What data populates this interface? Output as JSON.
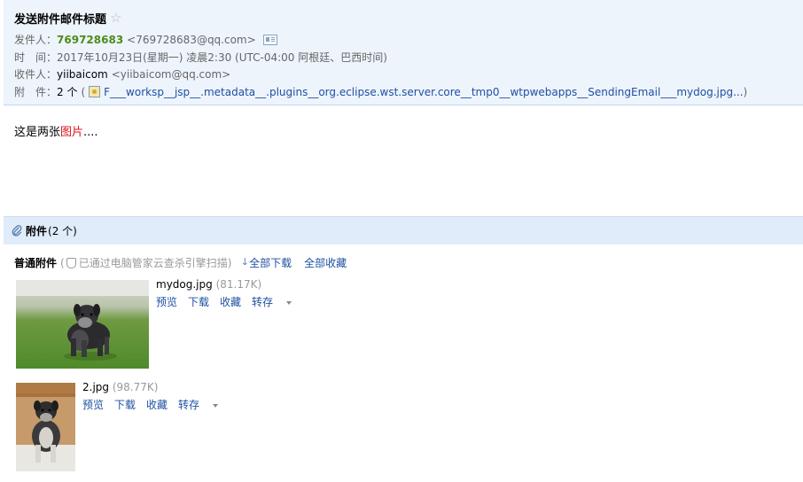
{
  "email": {
    "subject": "发送附件邮件标题",
    "star_icon": "star-outline-icon",
    "sender_label": "发件人：",
    "sender_name": "769728683",
    "sender_address": "<769728683@qq.com>",
    "contact_card_icon": "contact-card-icon",
    "time_label": "时　间：",
    "time_value": "2017年10月23日(星期一) 凌晨2:30 (UTC-04:00 阿根廷、巴西时间)",
    "recipient_label": "收件人：",
    "recipient_name": "yiibaicom",
    "recipient_address": "<yiibaicom@qq.com>",
    "attachment_label": "附　件：",
    "attachment_count": "2 个",
    "attachment_paren_open": "(",
    "attachment_paren_close": ")",
    "attachment_link": "F___worksp__jsp__.metadata__.plugins__org.eclipse.wst.server.core__tmp0__wtpwebapps__SendingEmail___mydog.jpg...",
    "body_text_before": "这是两张",
    "body_text_red": "图片",
    "body_text_after": "...."
  },
  "attachments_panel": {
    "title": "附件",
    "count": "(2 个)",
    "kind_label": "普通附件",
    "scan_text_open": "(",
    "scan_text": "已通过电脑管家云查杀引擎扫描",
    "scan_text_close": ")",
    "download_all": "全部下载",
    "save_all": "全部收藏",
    "files": [
      {
        "name": "mydog.jpg",
        "size": "(81.17K)",
        "preview": "预览",
        "download": "下载",
        "favorite": "收藏",
        "save_to": "转存"
      },
      {
        "name": "2.jpg",
        "size": "(98.77K)",
        "preview": "预览",
        "download": "下载",
        "favorite": "收藏",
        "save_to": "转存"
      }
    ]
  },
  "colors": {
    "header_bg": "#eef4fc",
    "link_blue": "#1e50a2",
    "sender_green": "#4d8c1b",
    "body_red": "#e0101a"
  }
}
